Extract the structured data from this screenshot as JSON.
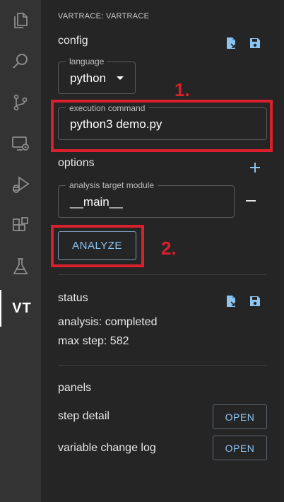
{
  "activity_bar": {
    "items": [
      {
        "icon": "files-icon"
      },
      {
        "icon": "search-icon"
      },
      {
        "icon": "source-control-icon"
      },
      {
        "icon": "remote-explorer-icon"
      },
      {
        "icon": "run-debug-icon"
      },
      {
        "icon": "extensions-icon"
      },
      {
        "icon": "testing-icon"
      },
      {
        "icon": "vartrace-icon",
        "label": "VT"
      }
    ]
  },
  "panel": {
    "title": "VARTRACE: VARTRACE",
    "config": {
      "title": "config",
      "language_legend": "language",
      "language_value": "python",
      "exec_legend": "execution command",
      "exec_value": "python3 demo.py"
    },
    "options": {
      "title": "options",
      "module_legend": "analysis target module",
      "module_value": "__main__"
    },
    "analyze_label": "ANALYZE",
    "annotations": {
      "one": "1.",
      "two": "2."
    },
    "status": {
      "title": "status",
      "analysis": "analysis: completed",
      "max_step": "max step: 582"
    },
    "panels": {
      "title": "panels",
      "rows": [
        {
          "label": "step detail",
          "button": "OPEN"
        },
        {
          "label": "variable change log",
          "button": "OPEN"
        }
      ]
    }
  },
  "colors": {
    "accent": "#8cc4f2",
    "highlight": "#d9202c",
    "activity_bar": "#333333",
    "panel_bg": "#252526"
  }
}
